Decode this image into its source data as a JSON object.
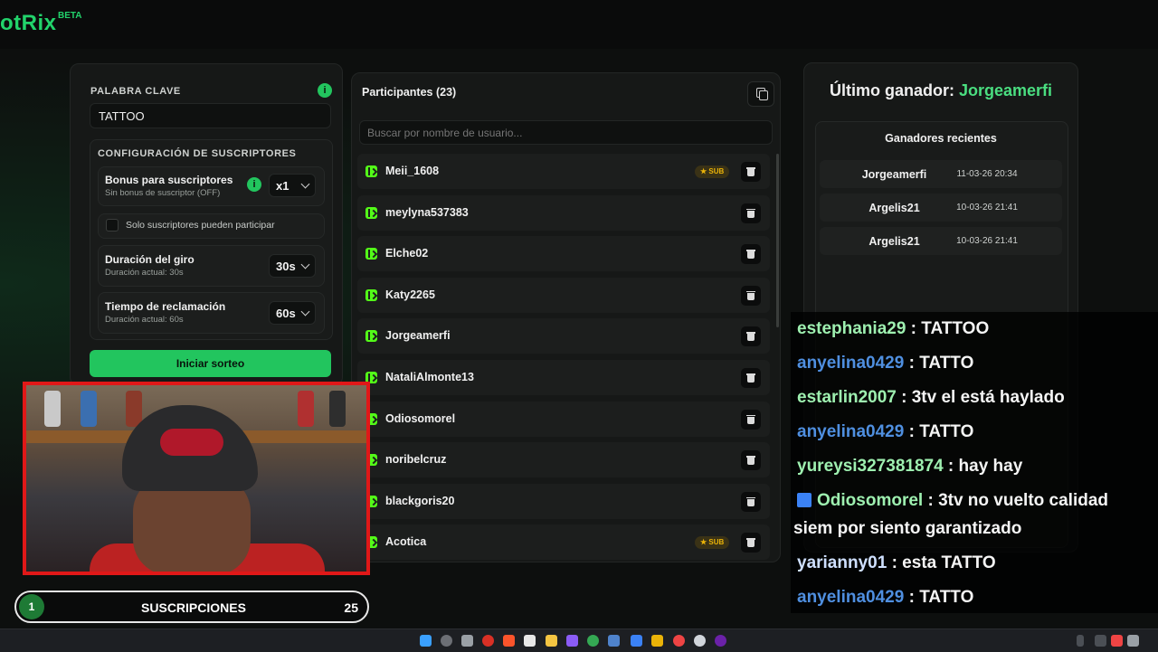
{
  "app": {
    "logo": "otRix",
    "beta": "BETA"
  },
  "keyword": {
    "label": "PALABRA CLAVE",
    "value": "TATTOO",
    "info": "i"
  },
  "subscriber_config": {
    "title": "CONFIGURACIÓN DE SUSCRIPTORES",
    "bonus": {
      "title": "Bonus para suscriptores",
      "subtitle": "Sin bonus de suscriptor (OFF)",
      "value": "x1"
    },
    "only_subs": {
      "label": "Solo suscriptores pueden participar"
    },
    "spin": {
      "title": "Duración del giro",
      "subtitle": "Duración actual: 30s",
      "value": "30s"
    },
    "claim": {
      "title": "Tiempo de reclamación",
      "subtitle": "Duración actual: 60s",
      "value": "60s"
    }
  },
  "start_button": "Iniciar sorteo",
  "participants": {
    "title": "Participantes (23)",
    "search_placeholder": "Buscar por nombre de usuario...",
    "sub_badge": "★ SUB",
    "items": [
      {
        "name": "Meii_1608",
        "sub": true
      },
      {
        "name": "meylyna537383",
        "sub": false
      },
      {
        "name": "Elche02",
        "sub": false
      },
      {
        "name": "Katy2265",
        "sub": false
      },
      {
        "name": "Jorgeamerfi",
        "sub": false
      },
      {
        "name": "NataliAlmonte13",
        "sub": false
      },
      {
        "name": "Odiosomorel",
        "sub": false
      },
      {
        "name": "noribelcruz",
        "sub": false
      },
      {
        "name": "blackgoris20",
        "sub": false
      },
      {
        "name": "Acotica",
        "sub": true
      }
    ]
  },
  "winner": {
    "label": "Último ganador:",
    "name": "Jorgeamerfi",
    "recent_title": "Ganadores recientes",
    "recent": [
      {
        "name": "Jorgeamerfi",
        "date": "11-03-26 20:34"
      },
      {
        "name": "Argelis21",
        "date": "10-03-26 21:41"
      },
      {
        "name": "Argelis21",
        "date": "10-03-26 21:41"
      }
    ]
  },
  "counter": {
    "current": "1",
    "label": "SUSCRIPCIONES",
    "goal": "25"
  },
  "chat": [
    {
      "user": "estephania29",
      "color": "#9ef0b0",
      "text": " : TATTOO"
    },
    {
      "user": "anyelina0429",
      "color": "#4f8fe0",
      "text": " : TATTO"
    },
    {
      "user": "estarlin2007",
      "color": "#9ef0b0",
      "text": " : 3tv el está haylado"
    },
    {
      "user": "anyelina0429",
      "color": "#4f8fe0",
      "text": " : TATTO"
    },
    {
      "user": "yureysi327381874",
      "color": "#9ef0b0",
      "text": " : hay hay"
    },
    {
      "user": "Odiosomorel",
      "color": "#9ef0b0",
      "text": " : 3tv no vuelto calidad"
    },
    {
      "user": "",
      "color": "#f5f5f5",
      "text": "siem por siento garantizado"
    },
    {
      "user": "yarianny01",
      "color": "#cfe0ff",
      "text": " : esta TATTO"
    },
    {
      "user": "anyelina0429",
      "color": "#4f8fe0",
      "text": " : TATTO"
    }
  ],
  "colors": {
    "accent": "#22c55e",
    "kick": "#53fc18",
    "sub_badge": "#eab308",
    "cam_frame": "#e01818"
  }
}
